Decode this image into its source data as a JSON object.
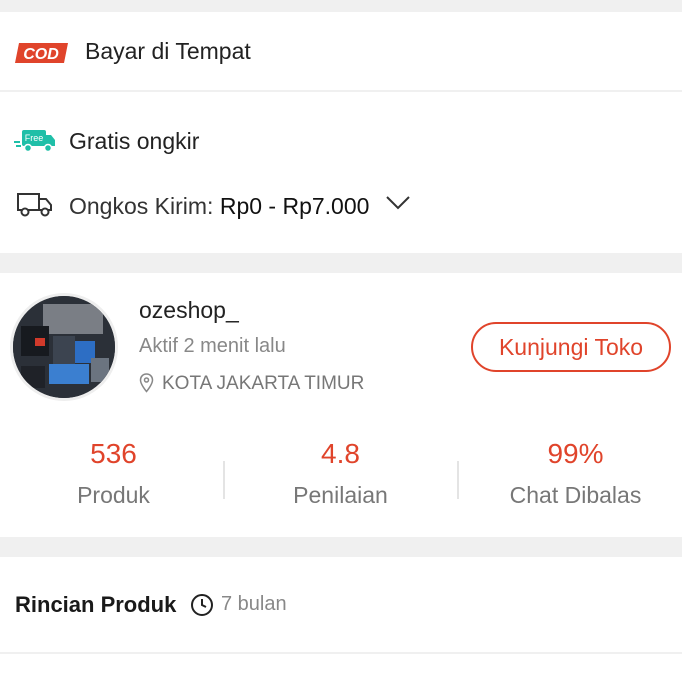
{
  "payment": {
    "badge_text": "COD",
    "label": "Bayar di Tempat",
    "badge_color": "#e0442b"
  },
  "shipping": {
    "free_badge_text": "Free",
    "free_label": "Gratis ongkir",
    "fee_label": "Ongkos Kirim:",
    "fee_value": "Rp0 - Rp7.000",
    "free_color": "#1fbfa8"
  },
  "shop": {
    "name": "ozeshop_",
    "status": "Aktif 2 menit lalu",
    "location": "KOTA JAKARTA TIMUR",
    "visit_button": "Kunjungi Toko",
    "stats": [
      {
        "value": "536",
        "label": "Produk"
      },
      {
        "value": "4.8",
        "label": "Penilaian"
      },
      {
        "value": "99%",
        "label": "Chat Dibalas"
      }
    ],
    "accent_color": "#e0442b"
  },
  "details": {
    "title": "Rincian Produk",
    "age": "7 bulan"
  }
}
